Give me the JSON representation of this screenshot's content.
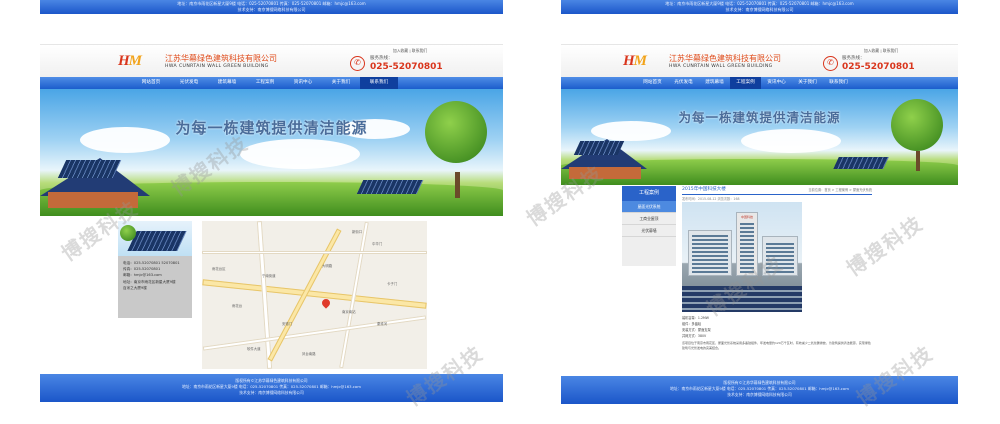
{
  "common": {
    "company_cn": "江苏华幕绿色建筑科技有限公司",
    "company_en": "HWA CUNRTAIN WALL GREEN BUILDING",
    "logo_text_a": "H",
    "logo_text_b": "M",
    "toplinks": "加入收藏 | 联系我们",
    "phone_label": "服务热线：",
    "phone_number": "025-52070801",
    "slogan": "为每一栋建筑提供清洁能源",
    "nav": [
      "网站首页",
      "光伏发电",
      "建筑幕墙",
      "工程案例",
      "资讯中心",
      "关于我们",
      "联系我们"
    ],
    "footer_line1": "版权所有©江苏华幕绿色建筑科技有限公司",
    "footer_line2": "地址：南京市雨花区新星大厦9楼  电话：025-52070801  传真：025-52070801  邮箱：hmjc@163.com",
    "footer_line3": "技术支持：南京博搜网络科技有限公司"
  },
  "left": {
    "contact_lines": [
      "电话：025-52070801  52070801",
      "传真：025-52070801",
      "邮箱：hmjc@163.com",
      "地址：南京市雨花区新星大厦9楼",
      "百米之大厦9楼"
    ],
    "map_labels": [
      "雨花台区",
      "宁南街道",
      "大明路",
      "中华门",
      "雨花台",
      "南京南站",
      "安德门",
      "软件大道",
      "凤台南路",
      "新街口",
      "秦淮河",
      "卡子门"
    ]
  },
  "right": {
    "side_title": "工程案例",
    "side_items": [
      "屋面光伏系统",
      "工商业屋顶",
      "光伏幕墙"
    ],
    "article_title": "2015年中国科技大楼",
    "article_crumb": "当前位置：首页 > 工程案例 > 屋面光伏系统",
    "article_sub": "发布时间：2015-08-12  浏览次数：168",
    "building_sign": "中国科技",
    "specs": [
      "装机容量：1.2MW",
      "组件：多晶硅",
      "安装方式：屋面支架",
      "并网方式：380V"
    ],
    "body": "该项目位于南京市雨花区，屋面光伏系统采用多晶硅组件，年发电量约120万千瓦时，有效减少二氧化碳排放，为建筑提供清洁能源，实现绿色建筑与光伏发电的完美结合。"
  },
  "watermark": "博搜科技"
}
